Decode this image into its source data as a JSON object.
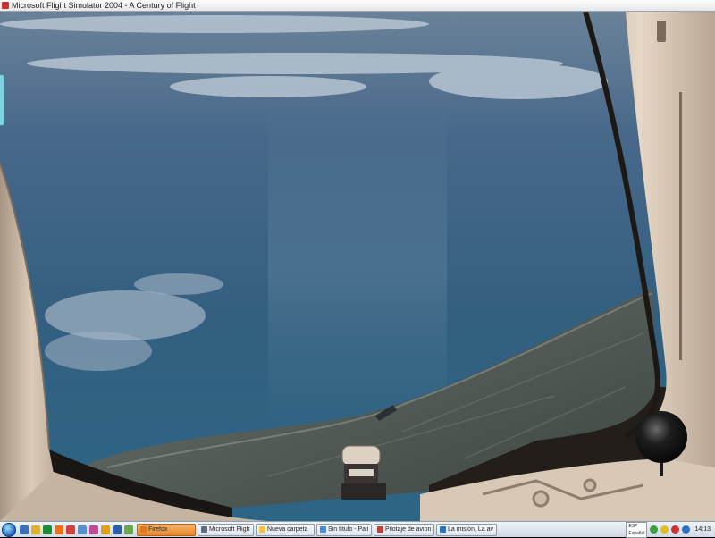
{
  "window": {
    "title": "Microsoft Flight Simulator 2004 - A Century of Flight"
  },
  "taskbar": {
    "buttons": [
      {
        "label": "Firefox",
        "width": 66,
        "active": true,
        "color": "#e8731c"
      },
      {
        "label": "Microsoft Flight Si...",
        "width": 63,
        "active": false,
        "color": "#5a6e82"
      },
      {
        "label": "Nueva carpeta",
        "width": 66,
        "active": false,
        "color": "#f0c040"
      },
      {
        "label": "Sin título - Paint",
        "width": 62,
        "active": false,
        "color": "#4a8ad0"
      },
      {
        "label": "Pilotaje de aviones...",
        "width": 68,
        "active": false,
        "color": "#c04040"
      },
      {
        "label": "La misión, La aven...",
        "width": 68,
        "active": false,
        "color": "#3070c0"
      }
    ],
    "language": [
      "ESP",
      "Español"
    ],
    "clock": "14:13"
  },
  "colors": {
    "sky_top": "#5f7890",
    "sea": "#2f5f80",
    "frame": "#d6c6b4",
    "frame_shadow": "#9b8b7b"
  }
}
